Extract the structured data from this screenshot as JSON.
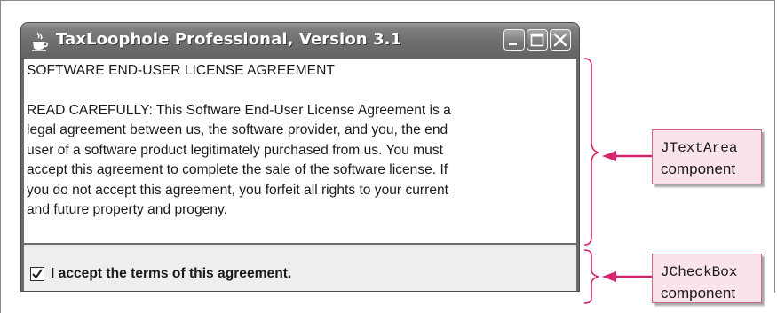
{
  "window": {
    "title": "TaxLoophole Professional, Version 3.1",
    "icon": "java-coffee-cup-icon",
    "controls": [
      "minimize-icon",
      "maximize-icon",
      "close-icon"
    ]
  },
  "textarea": {
    "lines": [
      "SOFTWARE END-USER LICENSE AGREEMENT",
      "",
      "READ CAREFULLY: This Software End-User License Agreement is a",
      "legal agreement between us, the software provider, and you, the end",
      "user of a software product legitimately purchased from us. You must",
      "accept this agreement to complete the sale of the software license. If",
      "you do not accept this agreement, you forfeit all rights to your current",
      "and future property and progeny."
    ]
  },
  "checkbox": {
    "label": "I accept the terms of this agreement.",
    "checked": true
  },
  "annotations": {
    "textarea": {
      "code": "JTextArea",
      "word": "component"
    },
    "checkbox": {
      "code": "JCheckBox",
      "word": "component"
    }
  },
  "colors": {
    "titlebar": "#6e6e6e",
    "callout_fill": "#fbe3ea",
    "callout_border": "#c9668a",
    "arrow": "#d6246e"
  }
}
